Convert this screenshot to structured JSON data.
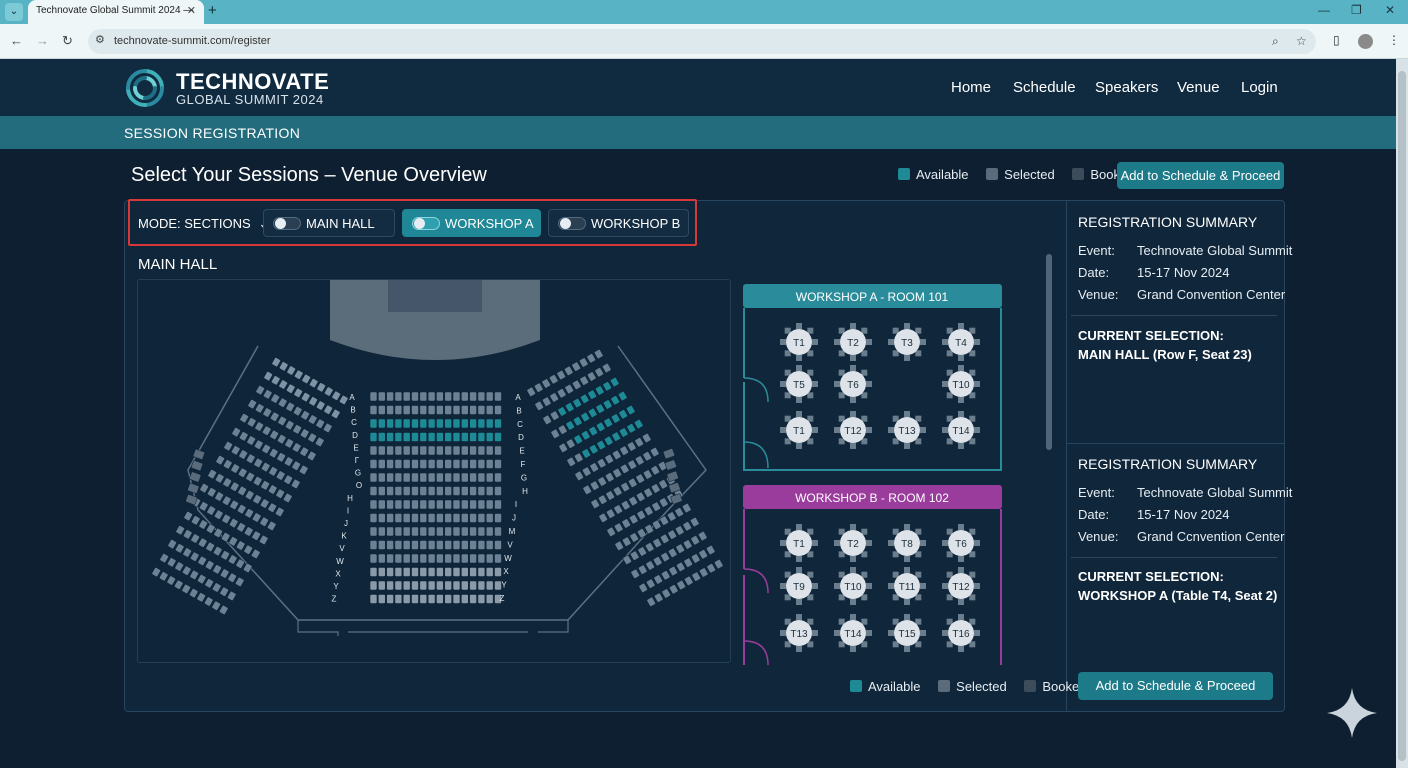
{
  "browser": {
    "tab_title": "Technovate Global Summit 2024 —",
    "tab_close": "✕",
    "new_tab": "+",
    "url": "technovate-summit.com/register",
    "win_min": "—",
    "win_max": "❐",
    "win_close": "✕",
    "icons": [
      "tab-menu-icon",
      "back-icon",
      "forward-icon",
      "reload-icon",
      "site-info-icon",
      "zoom-icon",
      "bookmark-star-icon",
      "sidebar-icon",
      "profile-icon",
      "menu-kebab-icon"
    ]
  },
  "header": {
    "logo_title": "TECHNOVATE",
    "logo_subtitle": "GLOBAL SUMMIT 2024",
    "nav": [
      "Home",
      "Schedule",
      "Speakers",
      "Venue",
      "Login"
    ]
  },
  "subbar": {
    "title": "SESSION REGISTRATION"
  },
  "page": {
    "title": "Select Your Sessions – Venue Overview",
    "legend": {
      "available": "Available",
      "selected": "Selected",
      "booked": "Booked"
    },
    "proceed_button": "Add to Schedule & Proceed"
  },
  "mode": {
    "label": "MODE: SECTIONS",
    "toggles": [
      {
        "label": "MAIN HALL",
        "active": false
      },
      {
        "label": "WORKSHOP A",
        "active": true
      },
      {
        "label": "WORKSHOP B",
        "active": false
      }
    ]
  },
  "main_hall": {
    "heading": "MAIN HALL",
    "row_letters_left": [
      "A",
      "B",
      "C",
      "D",
      "E",
      "Γ",
      "G",
      "O",
      "H",
      "I",
      "J",
      "K",
      "V",
      "W",
      "X",
      "Y",
      "Z"
    ],
    "row_letters_right": [
      "A",
      "B",
      "C",
      "D",
      "E",
      "F",
      "G",
      "H",
      "I",
      "J",
      "M",
      "V",
      "W",
      "X",
      "Y",
      "Z"
    ]
  },
  "workshop_a": {
    "title": "WORKSHOP A - ROOM 101",
    "tables": [
      "T1",
      "T2",
      "T3",
      "T4",
      "T5",
      "T6",
      "T10",
      "T1",
      "T12",
      "T13",
      "T14"
    ]
  },
  "workshop_b": {
    "title": "WORKSHOP B - ROOM 102",
    "tables": [
      "T1",
      "T2",
      "T8",
      "T6",
      "T9",
      "T10",
      "T11",
      "T12",
      "T13",
      "T14",
      "T15",
      "T16"
    ]
  },
  "legend_bottom": {
    "available": "Available",
    "selected": "Selected",
    "booked": "Booked"
  },
  "summary_1": {
    "title": "REGISTRATION SUMMARY",
    "event_k": "Event:",
    "event_v": "Technovate Global Summit",
    "date_k": "Date:",
    "date_v": "15-17 Nov 2024",
    "venue_k": "Venue:",
    "venue_v": "Grand Convention Center",
    "current_label": "CURRENT SELECTION:",
    "current_value": "MAIN HALL (Row F, Seat 23)"
  },
  "summary_2": {
    "title": "REGISTRATION SUMMARY",
    "event_k": "Event:",
    "event_v": "Technovate Global Summit",
    "date_k": "Date:",
    "date_v": "15-17 Nov 2024",
    "venue_k": "Venue:",
    "venue_v": "Grand Ccnvention Center",
    "current_label": "CURRENT SELECTION:",
    "current_value": "WORKSHOP A (Table T4, Seat 2)"
  },
  "summary_button": "Add to Schedule & Proceed",
  "colors": {
    "available": "#1d8a96",
    "selected": "#5a6c7c",
    "booked": "#3c4c5a",
    "workshop_a_accent": "#2a8c9a",
    "workshop_b_accent": "#9a3c9c"
  }
}
